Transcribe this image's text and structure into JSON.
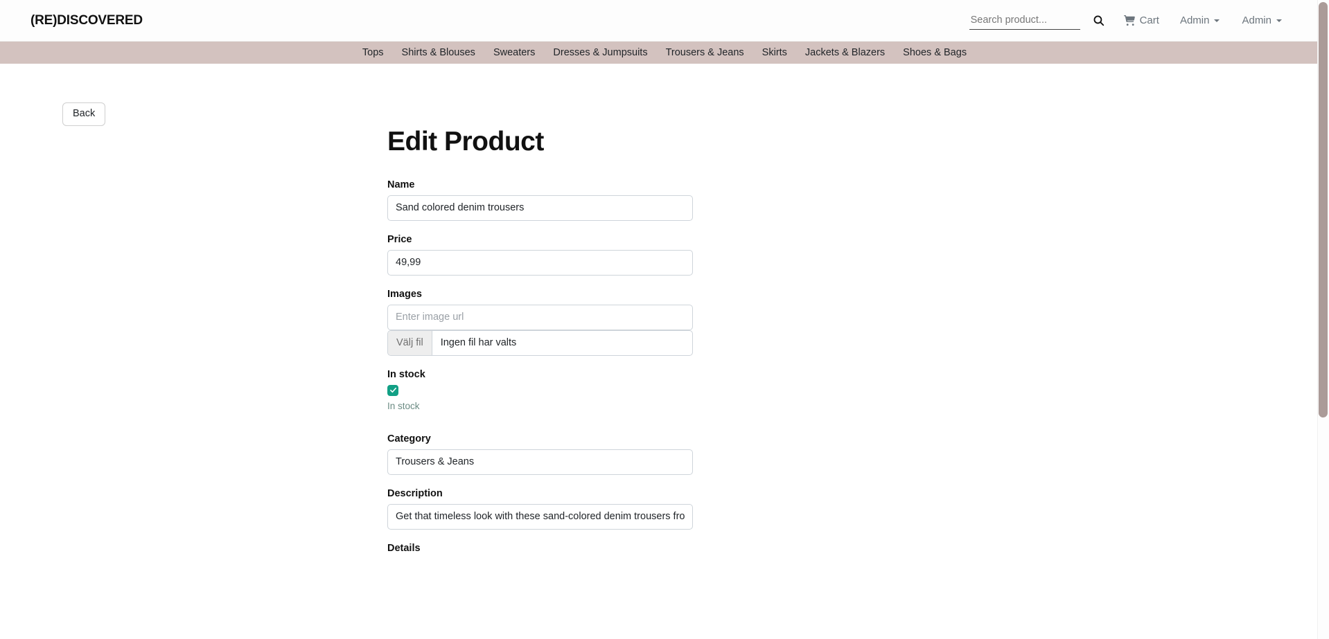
{
  "header": {
    "brand": "(RE)DISCOVERED",
    "search": {
      "placeholder": "Search product...",
      "value": "",
      "button_icon": "search-icon"
    },
    "cart": {
      "label": "Cart",
      "icon": "shopping-cart-icon"
    },
    "menus": [
      {
        "label": "Admin"
      },
      {
        "label": "Admin"
      }
    ]
  },
  "category_nav": {
    "items": [
      {
        "label": "Tops"
      },
      {
        "label": "Shirts & Blouses"
      },
      {
        "label": "Sweaters"
      },
      {
        "label": "Dresses & Jumpsuits"
      },
      {
        "label": "Trousers & Jeans"
      },
      {
        "label": "Skirts"
      },
      {
        "label": "Jackets & Blazers"
      },
      {
        "label": "Shoes & Bags"
      }
    ]
  },
  "main": {
    "back_button": "Back",
    "title": "Edit Product",
    "fields": {
      "name": {
        "label": "Name",
        "value": "Sand colored denim trousers"
      },
      "price": {
        "label": "Price",
        "value": "49,99"
      },
      "images": {
        "label": "Images",
        "url_placeholder": "Enter image url",
        "url_value": "",
        "file_button": "Välj fil",
        "file_status": "Ingen fil har valts"
      },
      "in_stock": {
        "label": "In stock",
        "checkbox_label": "In stock",
        "checked": true
      },
      "category": {
        "label": "Category",
        "value": "Trousers & Jeans"
      },
      "description": {
        "label": "Description",
        "value": "Get that timeless look with these sand-colored denim trousers from Flash. In E"
      },
      "details": {
        "label": "Details"
      }
    }
  },
  "colors": {
    "nav_bar": "#d3c2bf",
    "checkbox_accent": "#12a085",
    "scrollbar_thumb": "#ab9b98"
  }
}
